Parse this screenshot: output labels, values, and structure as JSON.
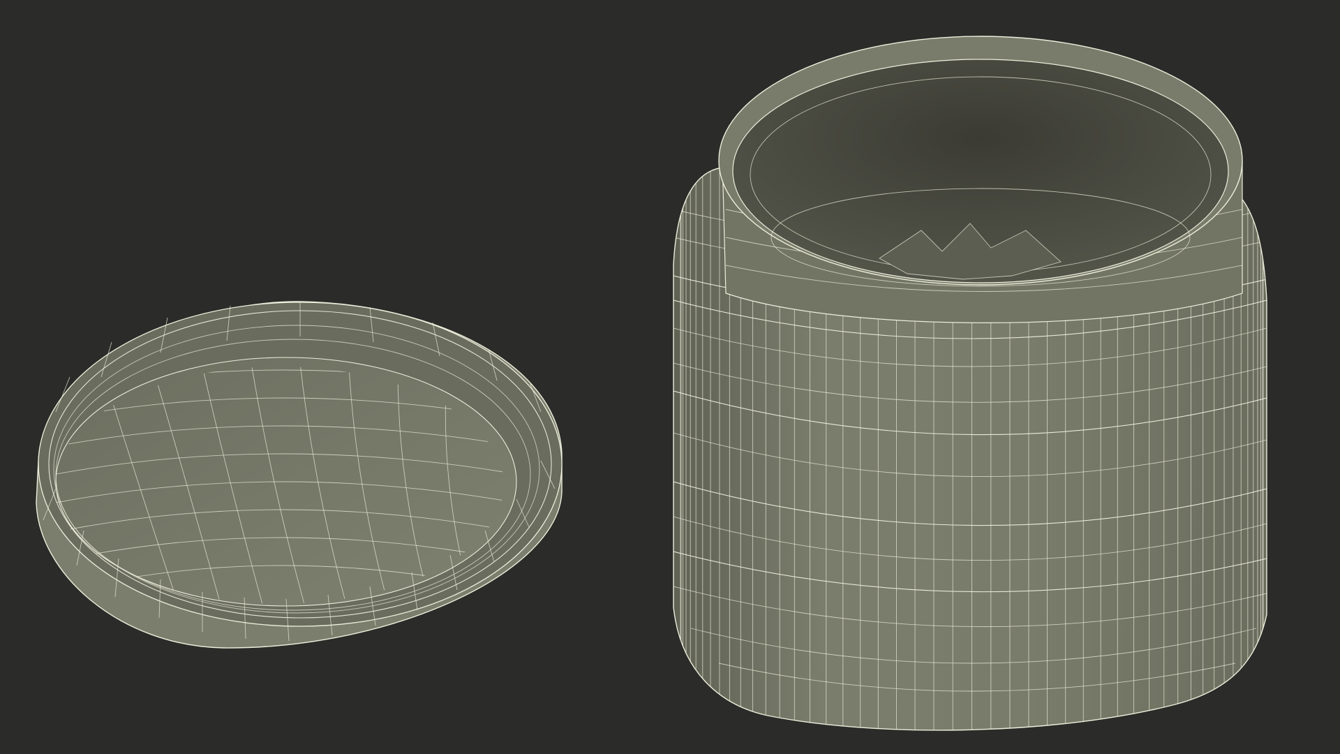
{
  "scene": {
    "background_color": "#2b2b29",
    "wire_color": "#eeeedc",
    "surface_color": "#7b7d6d",
    "objects": [
      {
        "name": "lid",
        "description_icon": "jar-lid-wireframe"
      },
      {
        "name": "jar",
        "description_icon": "jar-body-wireframe"
      }
    ]
  }
}
